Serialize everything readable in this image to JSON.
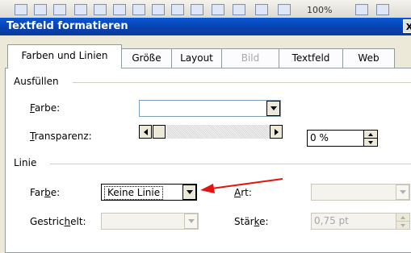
{
  "toolbar": {
    "zoom": "100%"
  },
  "window": {
    "title": "Textfeld formatieren",
    "close_label": "X"
  },
  "tabs": [
    {
      "label": "Farben und Linien",
      "active": true,
      "disabled": false
    },
    {
      "label": "Größe",
      "active": false,
      "disabled": false
    },
    {
      "label": "Layout",
      "active": false,
      "disabled": false
    },
    {
      "label": "Bild",
      "active": false,
      "disabled": true
    },
    {
      "label": "Textfeld",
      "active": false,
      "disabled": false
    },
    {
      "label": "Web",
      "active": false,
      "disabled": false
    }
  ],
  "fill": {
    "group_label": "Ausfüllen",
    "color_label_u": "F",
    "color_label_rest": "arbe:",
    "color_value": "",
    "transparency_label_u": "T",
    "transparency_label_rest": "ransparenz:",
    "transparency_value": "0 %"
  },
  "line": {
    "group_label": "Linie",
    "color_label_pre": "Far",
    "color_label_u": "b",
    "color_label_post": "e:",
    "color_value": "Keine Linie",
    "dashed_label_pre": "Gestric",
    "dashed_label_u": "h",
    "dashed_label_post": "elt:",
    "type_label_u": "A",
    "type_label_rest": "rt:",
    "weight_label_pre": "Stär",
    "weight_label_u": "k",
    "weight_label_post": "e:",
    "weight_value": "0,75 pt"
  },
  "colors": {
    "title_bar": "#0842b0",
    "dialog_bg": "#ece9d8",
    "annotation_arrow": "#e3140e"
  },
  "annotation": {
    "icon": "red-arrow-icon"
  }
}
